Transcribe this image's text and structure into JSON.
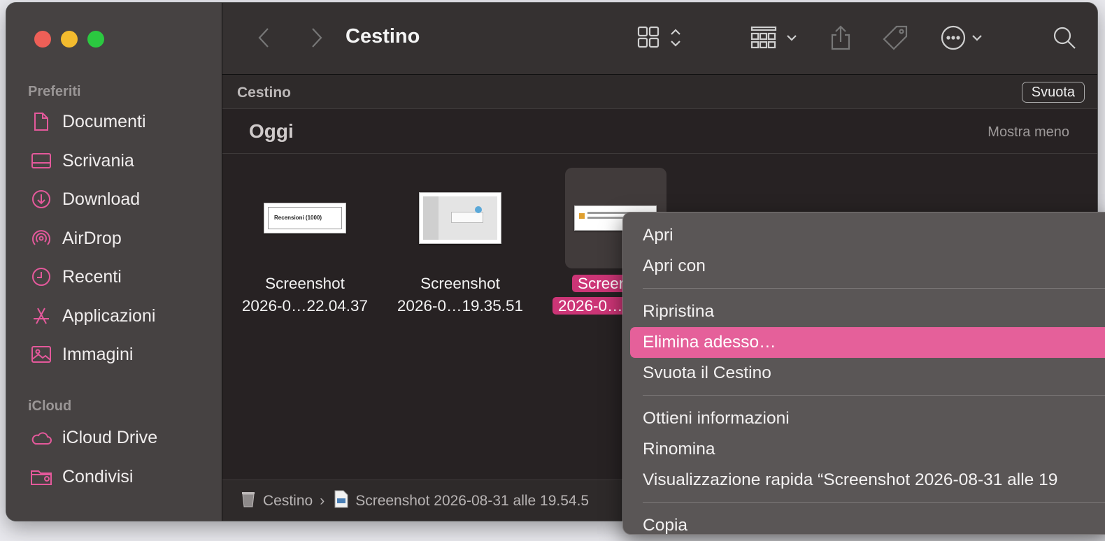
{
  "window": {
    "title": "Cestino"
  },
  "sidebar": {
    "favorites_title": "Preferiti",
    "favorites": [
      {
        "label": "Documenti",
        "icon": "document-icon"
      },
      {
        "label": "Scrivania",
        "icon": "desktop-icon"
      },
      {
        "label": "Download",
        "icon": "download-icon"
      },
      {
        "label": "AirDrop",
        "icon": "airdrop-icon"
      },
      {
        "label": "Recenti",
        "icon": "clock-icon"
      },
      {
        "label": "Applicazioni",
        "icon": "applications-icon"
      },
      {
        "label": "Immagini",
        "icon": "photo-icon"
      }
    ],
    "icloud_title": "iCloud",
    "icloud": [
      {
        "label": "iCloud Drive",
        "icon": "cloud-icon"
      },
      {
        "label": "Condivisi",
        "icon": "shared-folder-icon"
      }
    ]
  },
  "path_header": {
    "label": "Cestino",
    "empty_button": "Svuota"
  },
  "group": {
    "title": "Oggi",
    "toggle": "Mostra meno"
  },
  "files": [
    {
      "line1": "Screenshot",
      "line2": "2026-0…22.04.37",
      "thumb_text": "Recensioni (1000)"
    },
    {
      "line1": "Screenshot",
      "line2": "2026-0…19.35.51"
    },
    {
      "line1": "Screer",
      "line2": "2026-0…1"
    }
  ],
  "statusbar": {
    "trash": "Cestino",
    "separator": "›",
    "file": "Screenshot 2026-08-31 alle 19.54.5"
  },
  "context_menu": {
    "items": [
      "Apri",
      "Apri con",
      "Ripristina",
      "Elimina adesso…",
      "Svuota il Cestino",
      "Ottieni informazioni",
      "Rinomina",
      "Visualizzazione rapida “Screenshot 2026-08-31 alle 19",
      "Copia"
    ],
    "highlighted": "Elimina adesso…"
  },
  "colors": {
    "accent": "#e4599b",
    "highlight": "#e5609a",
    "selection": "#cc3576"
  }
}
